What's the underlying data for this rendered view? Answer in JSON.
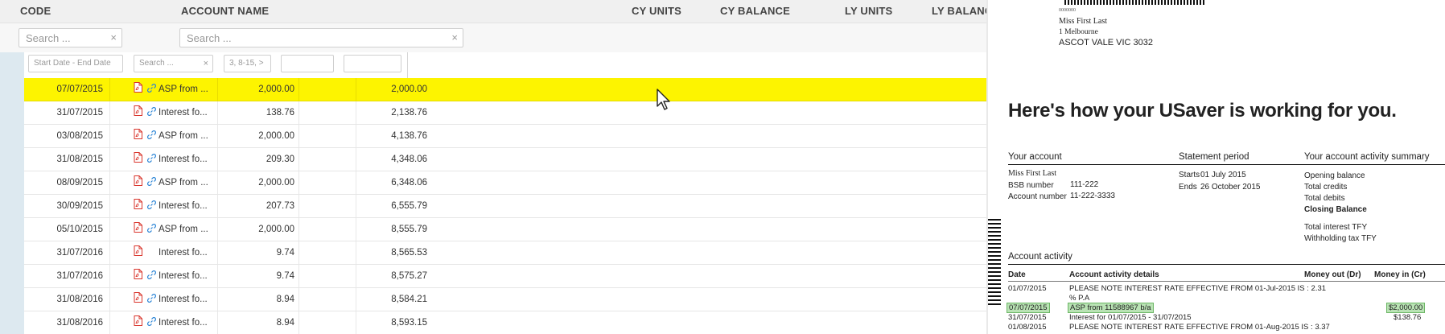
{
  "columns": {
    "code": "CODE",
    "account_name": "ACCOUNT NAME",
    "cy_units": "CY UNITS",
    "cy_balance": "CY BALANCE",
    "ly_units": "LY UNITS",
    "ly_balance": "LY BALANC"
  },
  "search": {
    "code_placeholder": "Search ...",
    "account_placeholder": "Search ...",
    "clear_glyph": "×"
  },
  "filters": {
    "date_start": "Start Date",
    "date_sep": "-",
    "date_end": "End Date",
    "desc_placeholder": "Search ...",
    "amount_value": "3, 8-15, >"
  },
  "rows": [
    {
      "date": "07/07/2015",
      "desc": "ASP from ...",
      "amount": "2,000.00",
      "balance": "2,000.00",
      "link": true
    },
    {
      "date": "31/07/2015",
      "desc": "Interest fo...",
      "amount": "138.76",
      "balance": "2,138.76",
      "link": true
    },
    {
      "date": "03/08/2015",
      "desc": "ASP from ...",
      "amount": "2,000.00",
      "balance": "4,138.76",
      "link": true
    },
    {
      "date": "31/08/2015",
      "desc": "Interest fo...",
      "amount": "209.30",
      "balance": "4,348.06",
      "link": true
    },
    {
      "date": "08/09/2015",
      "desc": "ASP from ...",
      "amount": "2,000.00",
      "balance": "6,348.06",
      "link": true
    },
    {
      "date": "30/09/2015",
      "desc": "Interest fo...",
      "amount": "207.73",
      "balance": "6,555.79",
      "link": true
    },
    {
      "date": "05/10/2015",
      "desc": "ASP from ...",
      "amount": "2,000.00",
      "balance": "8,555.79",
      "link": true
    },
    {
      "date": "31/07/2016",
      "desc": "Interest fo...",
      "amount": "9.74",
      "balance": "8,565.53",
      "link": false
    },
    {
      "date": "31/07/2016",
      "desc": "Interest fo...",
      "amount": "9.74",
      "balance": "8,575.27",
      "link": true
    },
    {
      "date": "31/08/2016",
      "desc": "Interest fo...",
      "amount": "8.94",
      "balance": "8,584.21",
      "link": true
    },
    {
      "date": "31/08/2016",
      "desc": "Interest fo...",
      "amount": "8.94",
      "balance": "8,593.15",
      "link": true
    }
  ],
  "highlight_color": "#fdf400",
  "icons": {
    "pdf": "pdf-file-icon",
    "link": "link-icon",
    "cursor": "mouse-pointer-icon"
  },
  "statement": {
    "address_ref": "0000000",
    "name": "Miss First Last",
    "street": "1 Melbourne",
    "city": "ASCOT VALE VIC 3032",
    "headline": "Here's how your USaver is working for you.",
    "your_account_heading": "Your account",
    "account_name": "Miss First Last",
    "bsb_label": "BSB number",
    "bsb": "111-222",
    "acct_label": "Account number",
    "acct": "11-222-3333",
    "period_heading": "Statement period",
    "starts_label": "Starts",
    "starts": "01 July 2015",
    "ends_label": "Ends",
    "ends": "26 October 2015",
    "summary_heading": "Your account activity summary",
    "opening": "Opening balance",
    "credits": "Total credits",
    "debits": "Total debits",
    "closing": "Closing Balance",
    "interest_tfy": "Total interest TFY",
    "withholding": "Withholding tax TFY",
    "activity_heading": "Account activity",
    "th_date": "Date",
    "th_details": "Account activity details",
    "th_out": "Money out (Dr)",
    "th_in": "Money in (Cr)",
    "lines": [
      {
        "date": "01/07/2015",
        "text": "PLEASE NOTE INTEREST RATE EFFECTIVE FROM 01-Jul-2015 IS : 2.31",
        "in": ""
      },
      {
        "date": "",
        "text": "% P.A",
        "in": ""
      },
      {
        "date": "07/07/2015",
        "text": "ASP from 11588967 b/a",
        "in": "$2,000.00"
      },
      {
        "date": "31/07/2015",
        "text": "Interest for 01/07/2015 - 31/07/2015",
        "in": "$138.76"
      },
      {
        "date": "01/08/2015",
        "text": "PLEASE NOTE INTEREST RATE EFFECTIVE FROM 01-Aug-2015 IS : 3.37",
        "in": ""
      }
    ]
  }
}
